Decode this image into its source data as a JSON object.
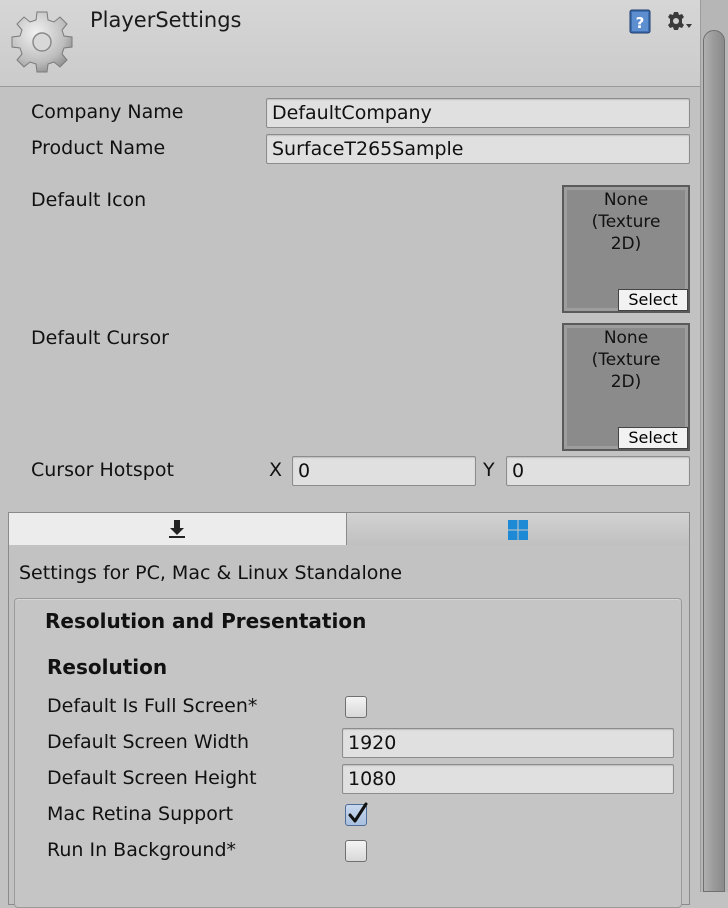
{
  "header": {
    "title": "PlayerSettings",
    "icon": "gear-icon",
    "help_icon": "help-book-icon",
    "settings_icon": "settings-menu-icon"
  },
  "fields": {
    "company_name_label": "Company Name",
    "company_name_value": "DefaultCompany",
    "product_name_label": "Product Name",
    "product_name_value": "SurfaceT265Sample",
    "default_icon_label": "Default Icon",
    "default_icon_value": [
      "None",
      "(Texture",
      "2D)"
    ],
    "default_cursor_label": "Default Cursor",
    "default_cursor_value": [
      "None",
      "(Texture",
      "2D)"
    ],
    "select_label": "Select",
    "cursor_hotspot_label": "Cursor Hotspot",
    "hotspot_x_label": "X",
    "hotspot_x_value": "0",
    "hotspot_y_label": "Y",
    "hotspot_y_value": "0"
  },
  "tabs": [
    {
      "icon": "download-arrow-icon",
      "selected": true
    },
    {
      "icon": "windows-logo-icon",
      "selected": false
    }
  ],
  "platform_heading": "Settings for PC, Mac & Linux Standalone",
  "section": {
    "title": "Resolution and Presentation",
    "subsection": "Resolution",
    "rows": [
      {
        "label": "Default Is Full Screen*",
        "type": "checkbox",
        "checked": false
      },
      {
        "label": "Default Screen Width",
        "type": "field",
        "value": "1920"
      },
      {
        "label": "Default Screen Height",
        "type": "field",
        "value": "1080"
      },
      {
        "label": "Mac Retina Support",
        "type": "checkbox",
        "checked": true
      },
      {
        "label": "Run In Background*",
        "type": "checkbox",
        "checked": false
      }
    ]
  },
  "colors": {
    "background": "#c2c2c2",
    "field": "#e0e0e0",
    "windows_blue": "#1e8ad6",
    "check_blue": "#a9bfdf"
  }
}
